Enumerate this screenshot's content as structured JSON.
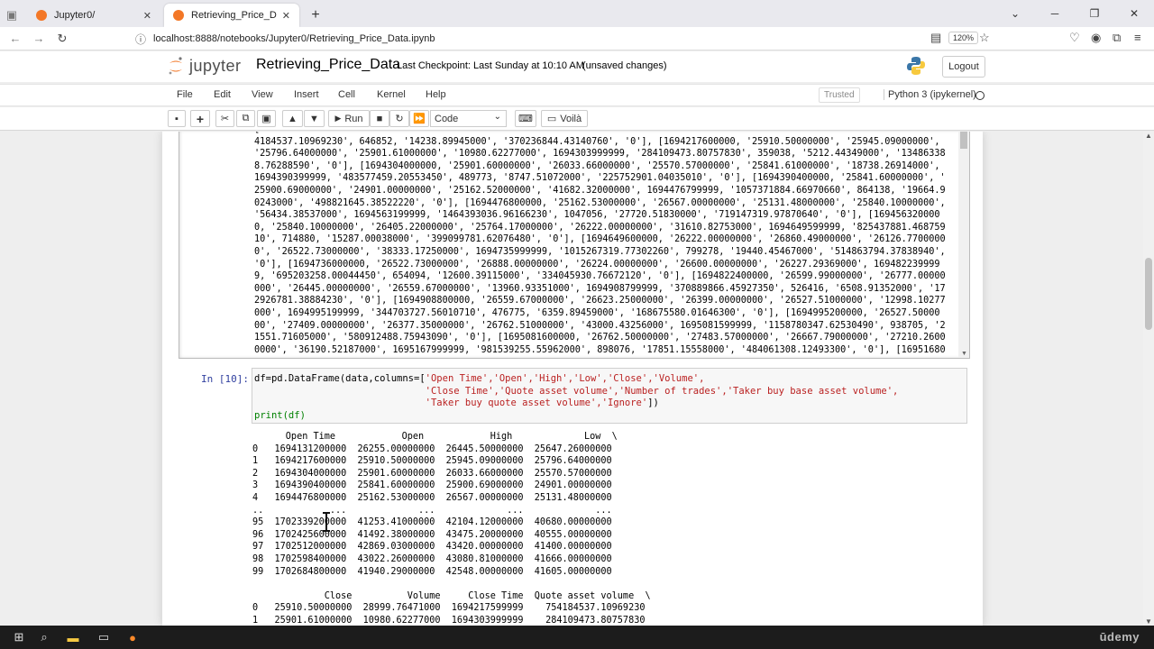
{
  "browser": {
    "tabs": [
      {
        "title": "Jupyter0/",
        "active": false
      },
      {
        "title": "Retrieving_Price_Data - Jupyter",
        "active": true
      }
    ],
    "url": "localhost:8888/notebooks/Jupyter0/Retrieving_Price_Data.ipynb",
    "zoom": "120%"
  },
  "header": {
    "logo_text": "jupyter",
    "notebook_name": "Retrieving_Price_Data",
    "checkpoint": "Last Checkpoint: Last Sunday at 10:10 AM",
    "unsaved": "(unsaved changes)",
    "logout_label": "Logout"
  },
  "menu": {
    "items": [
      "File",
      "Edit",
      "View",
      "Insert",
      "Cell",
      "Kernel",
      "Help"
    ],
    "trusted": "Trusted",
    "kernel": "Python 3 (ipykernel)"
  },
  "toolbar": {
    "run_label": "Run",
    "cell_type": "Code",
    "voila_label": "Voilà"
  },
  "scrolled_output": {
    "text": "[                                                                                                               \n4184537.10969230', 646852, '14238.89945000', '370236844.43140760', '0'], [1694217600000, '25910.50000000', '25945.09000000',\n'25796.64000000', '25901.61000000', '10980.62277000', 1694303999999, '284109473.80757830', 359038, '5212.44349000', '13486338\n8.76288590', '0'], [1694304000000, '25901.60000000', '26033.66000000', '25570.57000000', '25841.61000000', '18738.26914000',\n1694390399999, '483577459.20553450', 489773, '8747.51072000', '225752901.04035010', '0'], [1694390400000, '25841.60000000', '\n25900.69000000', '24901.00000000', '25162.52000000', '41682.32000000', 1694476799999, '1057371884.66970660', 864138, '19664.9\n0243000', '498821645.38522220', '0'], [1694476800000, '25162.53000000', '26567.00000000', '25131.48000000', '25840.10000000',\n'56434.38537000', 1694563199999, '1464393036.96166230', 1047056, '27720.51830000', '719147319.97870640', '0'], [169456320000\n0, '25840.10000000', '26405.22000000', '25764.17000000', '26222.00000000', '31610.82753000', 1694649599999, '825437881.468759\n10', 714880, '15287.00038000', '399099781.62076480', '0'], [1694649600000, '26222.00000000', '26860.49000000', '26126.7700000\n0', '26522.73000000', '38333.17250000', 1694735999999, '1015267319.77302260', 799278, '19440.45467000', '514863794.37838940',\n'0'], [1694736000000, '26522.73000000', '26888.00000000', '26224.00000000', '26600.00000000', '26227.29369000', 169482239999\n9, '695203258.00044450', 654094, '12600.39115000', '334045930.76672120', '0'], [1694822400000, '26599.99000000', '26777.00000\n000', '26445.00000000', '26559.67000000', '13960.93351000', 1694908799999, '370889866.45927350', 526416, '6508.91352000', '17\n2926781.38884230', '0'], [1694908800000, '26559.67000000', '26623.25000000', '26399.00000000', '26527.51000000', '12998.10277\n000', 1694995199999, '344703727.56010710', 476775, '6359.89459000', '168675580.01646300', '0'], [1694995200000, '26527.50000\n00', '27409.00000000', '26377.35000000', '26762.51000000', '43000.43256000', 1695081599999, '1158780347.62530490', 938705, '2\n1551.71605000', '580912488.75943090', '0'], [1695081600000, '26762.50000000', '27483.57000000', '26667.79000000', '27210.2600\n0000', '36190.52187000', 1695167999999, '981539255.55962000', 898076, '17851.15558000', '484061308.12493300', '0'], [16951680"
  },
  "cell": {
    "prompt": "In [10]:",
    "code_line1_a": "df=pd.DataFrame(data,columns=[",
    "code_line1_b": "'Open Time','Open','High','Low','Close','Volume',",
    "code_line2": "'Close Time','Quote asset volume','Number of trades','Taker buy base asset volume',",
    "code_line3": "'Taker buy quote asset volume','Ignore'",
    "code_line3_end": "])",
    "code_line4": "print(df)"
  },
  "df_output": {
    "text": "      Open Time            Open            High             Low  \\\n0   1694131200000  26255.00000000  26445.50000000  25647.26000000\n1   1694217600000  25910.50000000  25945.09000000  25796.64000000\n2   1694304000000  25901.60000000  26033.66000000  25570.57000000\n3   1694390400000  25841.60000000  25900.69000000  24901.00000000\n4   1694476800000  25162.53000000  26567.00000000  25131.48000000\n..            ...             ...             ...             ...\n95  1702339200000  41253.41000000  42104.12000000  40680.00000000\n96  1702425600000  41492.38000000  43475.20000000  40555.00000000\n97  1702512000000  42869.03000000  43420.00000000  41400.00000000\n98  1702598400000  43022.26000000  43080.81000000  41666.00000000\n99  1702684800000  41940.29000000  42548.00000000  41605.00000000\n\n             Close          Volume     Close Time  Quote asset volume  \\\n0   25910.50000000  28999.76471000  1694217599999    754184537.10969230\n1   25901.61000000  10980.62277000  1694303999999    284109473.80757830"
  },
  "taskbar": {
    "brand": "ūdemy"
  },
  "colors": {
    "jupyter_orange": "#f37726",
    "prompt_blue": "#303f9f",
    "string_red": "#ba2121"
  }
}
